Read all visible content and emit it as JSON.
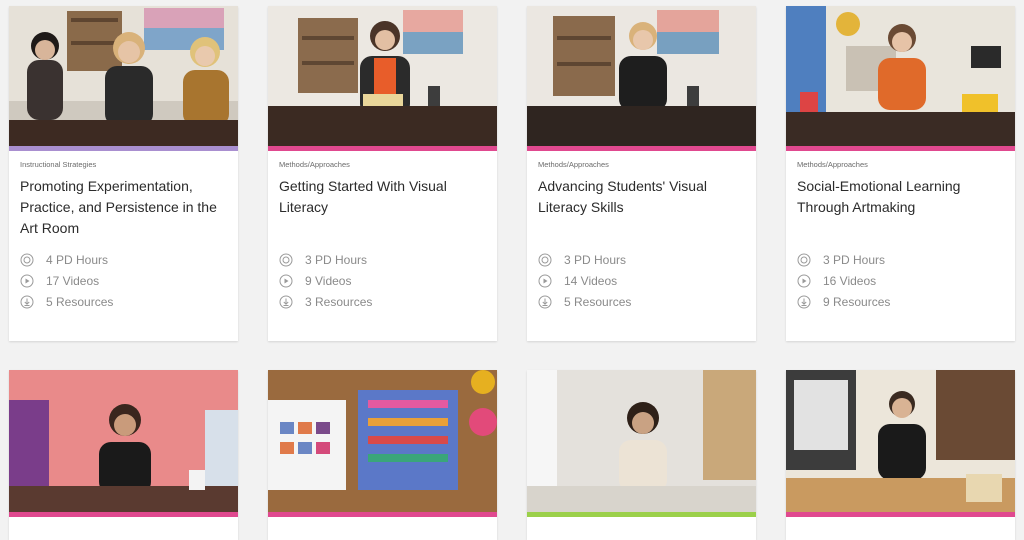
{
  "colors": {
    "instructional_strategies": "#a98fd0",
    "methods_approaches": "#e0498f",
    "media_techniques": "#e0498f",
    "advocacy": "#9bd04a"
  },
  "cards": [
    {
      "category": "Instructional Strategies",
      "title": "Promoting Experimentation, Practice, and Persistence in the Art Room",
      "hours": "4 PD Hours",
      "videos": "17 Videos",
      "resources": "5 Resources"
    },
    {
      "category": "Methods/Approaches",
      "title": "Getting Started With Visual Literacy",
      "hours": "3 PD Hours",
      "videos": "9 Videos",
      "resources": "3 Resources"
    },
    {
      "category": "Methods/Approaches",
      "title": "Advancing Students' Visual Literacy Skills",
      "hours": "3 PD Hours",
      "videos": "14 Videos",
      "resources": "5 Resources"
    },
    {
      "category": "Methods/Approaches",
      "title": "Social-Emotional Learning Through Artmaking",
      "hours": "3 PD Hours",
      "videos": "16 Videos",
      "resources": "9 Resources"
    }
  ],
  "icons": {
    "hours": "pd-hours-icon",
    "videos": "play-icon",
    "resources": "download-icon"
  }
}
